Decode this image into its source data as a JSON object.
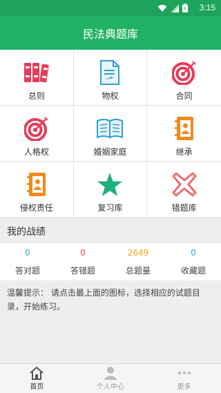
{
  "status_bar": {
    "time": "3:15"
  },
  "app_bar": {
    "title": "民法典题库"
  },
  "categories": [
    {
      "label": "总则",
      "icon": "binders-icon"
    },
    {
      "label": "物权",
      "icon": "document-icon"
    },
    {
      "label": "合同",
      "icon": "target-icon"
    },
    {
      "label": "人格权",
      "icon": "target-icon"
    },
    {
      "label": "婚姻家庭",
      "icon": "book-icon"
    },
    {
      "label": "继承",
      "icon": "contact-book-icon"
    },
    {
      "label": "侵权责任",
      "icon": "contact-book-icon"
    },
    {
      "label": "复习库",
      "icon": "star-icon"
    },
    {
      "label": "错题库",
      "icon": "cross-icon"
    }
  ],
  "section": {
    "title": "我的战绩"
  },
  "stats": [
    {
      "value": "0",
      "caption": "答对题",
      "color": "#2aa7d9"
    },
    {
      "value": "0",
      "caption": "答错题",
      "color": "#e9483b"
    },
    {
      "value": "2649",
      "caption": "总题量",
      "color": "#f2a516"
    },
    {
      "value": "0",
      "caption": "收藏题",
      "color": "#2aa7d9"
    }
  ],
  "tip": {
    "text": "温馨提示： 请点击最上面的图标，选择相应的试题目录，开始练习。"
  },
  "bottom_nav": [
    {
      "label": "首页",
      "icon": "home-icon"
    },
    {
      "label": "个人中心",
      "icon": "person-icon"
    },
    {
      "label": "更多",
      "icon": "more-icon"
    }
  ],
  "colors": {
    "primary": "#22b265",
    "status": "#1ea35a"
  }
}
